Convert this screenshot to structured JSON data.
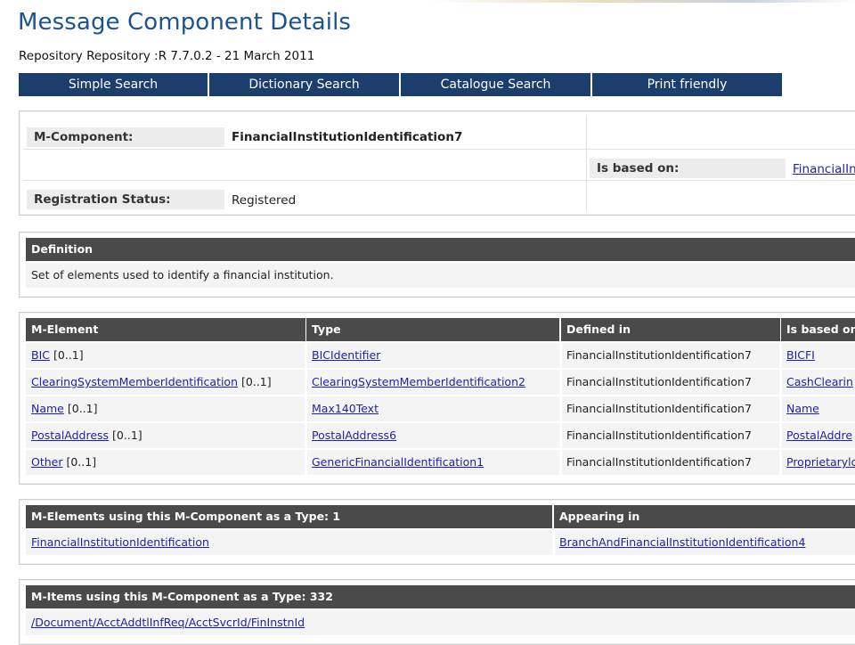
{
  "page": {
    "title": "Message Component Details",
    "repository_line": "Repository Repository :R 7.7.0.2 - 21 March 2011"
  },
  "nav": [
    {
      "label": "Simple Search"
    },
    {
      "label": "Dictionary Search"
    },
    {
      "label": "Catalogue Search"
    },
    {
      "label": "Print friendly"
    }
  ],
  "component": {
    "mcomponent_label": "M-Component:",
    "mcomponent_value": "FinancialInstitutionIdentification7",
    "based_on_label": "Is based on:",
    "based_on_value": "FinancialIn",
    "status_label": "Registration Status:",
    "status_value": "Registered"
  },
  "definition": {
    "header": "Definition",
    "text": "Set of elements used to identify a financial institution."
  },
  "elements_table": {
    "headers": [
      "M-Element",
      "Type",
      "Defined in",
      "Is based on"
    ],
    "rows": [
      {
        "name": "BIC",
        "mult": " [0..1]",
        "type": "BICIdentifier",
        "defined_in": "FinancialInstitutionIdentification7",
        "based_on": "BICFI"
      },
      {
        "name": "ClearingSystemMemberIdentification",
        "mult": " [0..1]",
        "type": "ClearingSystemMemberIdentification2",
        "defined_in": "FinancialInstitutionIdentification7",
        "based_on": "CashClearin"
      },
      {
        "name": "Name",
        "mult": " [0..1]",
        "type": "Max140Text",
        "defined_in": "FinancialInstitutionIdentification7",
        "based_on": "Name"
      },
      {
        "name": "PostalAddress",
        "mult": " [0..1]",
        "type": "PostalAddress6",
        "defined_in": "FinancialInstitutionIdentification7",
        "based_on": "PostalAddre"
      },
      {
        "name": "Other",
        "mult": " [0..1]",
        "type": "GenericFinancialIdentification1",
        "defined_in": "FinancialInstitutionIdentification7",
        "based_on": "Proprietaryld"
      }
    ]
  },
  "usage_table": {
    "headers": [
      "M-Elements using this M-Component as a Type: 1",
      "Appearing in"
    ],
    "rows": [
      {
        "element": "FinancialInstitutionIdentification",
        "appearing_in": "BranchAndFinancialInstitutionIdentification4"
      }
    ]
  },
  "items_table": {
    "header": "M-Items using this M-Component as a Type: 332",
    "rows": [
      {
        "path": "/Document/AcctAddtlInfReq/AcctSvcrId/FinInstnId"
      }
    ]
  }
}
